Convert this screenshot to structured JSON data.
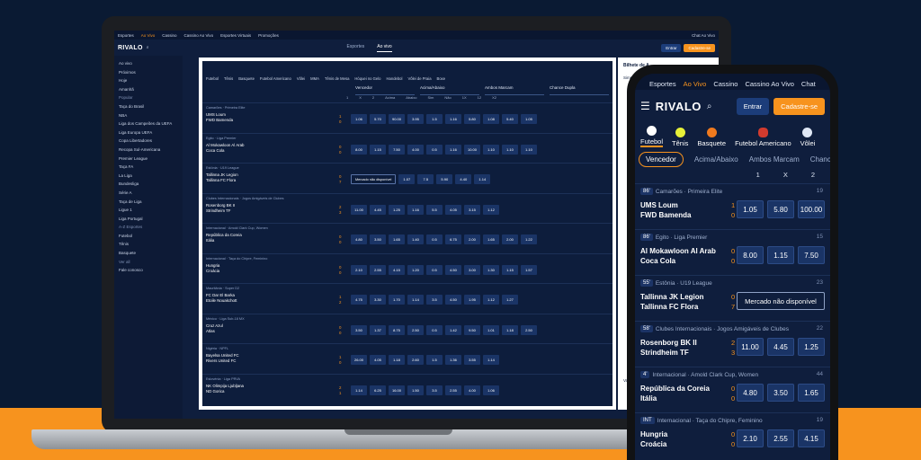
{
  "laptop": {
    "topnav": [
      "Esportes",
      "Ao Vivo",
      "Cassino",
      "Cassino Ao Vivo",
      "Esportes Virtuais",
      "Promoções"
    ],
    "chat": "Chat Ao Vivo",
    "logo": "RIVALO",
    "center_tabs": [
      "Esportes",
      "Ao vivo"
    ],
    "enter": "Entrar",
    "register": "Cadastre-se",
    "sidebar": [
      "Ao vivo",
      "Próximos",
      "Hoje",
      "Amanhã",
      "Popular",
      "Taça do Brasil",
      "NBA",
      "Liga dos Campeões da UEFA",
      "Liga Europa UEFA",
      "Copa Libertadores",
      "Recopa Sul-Americana",
      "Premier League",
      "Taça FA",
      "La Liga",
      "Bundesliga",
      "Série A",
      "Taça de Liga",
      "Ligue 1",
      "Liga Portugal",
      "A-Z Esportes",
      "Futebol",
      "Tênis",
      "Basquete",
      "Ver all",
      "Fale conosco"
    ],
    "sports": [
      "Futebol",
      "Tênis",
      "Basquete",
      "Futebol Americano",
      "Vôlei",
      "MMA",
      "Tênis de Mesa",
      "Hóquei no Gelo",
      "Handebol",
      "Vôlei de Praia",
      "Boxe"
    ],
    "markets": [
      "Vencedor",
      "Acima/Abaixo",
      "Ambos Marcam",
      "Chance Dupla"
    ],
    "colheads": [
      "1",
      "X",
      "2",
      "Acima",
      "Abaixo",
      "Sim",
      "Não",
      "1X",
      "12",
      "X2"
    ],
    "slip_title": "Bilhete de A",
    "slip_tab": "Simple",
    "slip_value": "Valor da",
    "matches": [
      {
        "league": "Camarões · Primeira Elite",
        "home": "UMS Loum",
        "away": "FWD Bamenda",
        "s1": "1",
        "s2": "0",
        "odds": [
          "1.06",
          "5.70",
          "90.00",
          "3.95",
          "1.5",
          "1.16",
          "5.80",
          "1.08",
          "5.40",
          "1.05"
        ]
      },
      {
        "league": "Egito · Liga Premier",
        "home": "Al Mokawloon Al Arab",
        "away": "Coca Cola",
        "s1": "0",
        "s2": "0",
        "odds": [
          "8.00",
          "1.15",
          "7.50",
          "4.00",
          "0.5",
          "1.16",
          "10.00",
          "1.10",
          "1.10",
          "1.10"
        ]
      },
      {
        "league": "Estônia · U19 League",
        "home": "Tallinna JK Legion",
        "away": "Tallinna FC Flora",
        "s1": "0",
        "s2": "7",
        "na": "Mercado não disponível",
        "odds": [
          "1.07",
          "7.5",
          "5.90",
          "4.40",
          "1.14"
        ]
      },
      {
        "league": "Clubes Internacionais · Jogos Amigáveis de Clubes",
        "home": "Rosenborg BK II",
        "away": "Strindheim TF",
        "s1": "2",
        "s2": "3",
        "odds": [
          "11.00",
          "4.45",
          "1.25",
          "1.16",
          "5.5",
          "4.05",
          "3.15",
          "1.12"
        ]
      },
      {
        "league": "Internacional · Amold Clark Cup, Women",
        "home": "República da Coreia",
        "away": "Itália",
        "s1": "0",
        "s2": "0",
        "odds": [
          "4.80",
          "3.50",
          "1.65",
          "1.40",
          "0.5",
          "6.75",
          "2.00",
          "1.65",
          "2.00",
          "1.22"
        ]
      },
      {
        "league": "Internacional · Taça do Chipre, Feminino",
        "home": "Hungria",
        "away": "Croácia",
        "s1": "0",
        "s2": "0",
        "odds": [
          "2.10",
          "2.55",
          "4.15",
          "1.20",
          "0.5",
          "4.50",
          "3.00",
          "1.30",
          "1.15",
          "1.57"
        ]
      },
      {
        "league": "Mauritânia · Super D2",
        "home": "FC Dar El Barka",
        "away": "Etoile Nouakchott",
        "s1": "1",
        "s2": "2",
        "odds": [
          "4.75",
          "3.30",
          "1.70",
          "1.14",
          "3.5",
          "4.50",
          "1.95",
          "1.12",
          "1.27"
        ]
      },
      {
        "league": "México · Liga Sub-18 MX",
        "home": "Cruz Azul",
        "away": "Atlas",
        "s1": "0",
        "s2": "0",
        "odds": [
          "3.50",
          "1.37",
          "8.75",
          "2.50",
          "0.5",
          "1.42",
          "9.50",
          "1.01",
          "1.18",
          "2.50"
        ]
      },
      {
        "league": "Nigéria · NPFL",
        "home": "Bayelsa United FC",
        "away": "Rivers United FC",
        "s1": "1",
        "s2": "0",
        "odds": [
          "26.00",
          "4.05",
          "1.18",
          "2.60",
          "1.5",
          "1.36",
          "3.55",
          "1.14"
        ]
      },
      {
        "league": "Eslovénia · Liga PRVA",
        "home": "NK Olimpija Ljubljana",
        "away": "ND Gorica",
        "s1": "2",
        "s2": "1",
        "odds": [
          "1.14",
          "6.25",
          "16.00",
          "1.50",
          "3.5",
          "2.55",
          "4.00",
          "1.06"
        ]
      }
    ]
  },
  "phone": {
    "topnav": [
      "Esportes",
      "Ao Vivo",
      "Cassino",
      "Cassino Ao Vivo",
      "Chat"
    ],
    "logo": "RIVALO",
    "enter": "Entrar",
    "register": "Cadastre-se",
    "sports": [
      "Futebol",
      "Tênis",
      "Basquete",
      "Futebol Americano",
      "Vôlei"
    ],
    "tabs": [
      "Vencedor",
      "Acima/Abaixo",
      "Ambos Marcam",
      "Chance D"
    ],
    "cols": [
      "1",
      "X",
      "2"
    ],
    "matches": [
      {
        "min": "86'",
        "league": "Camarões · Primeira Elite",
        "count": "19",
        "home": "UMS Loum",
        "away": "FWD Bamenda",
        "s1": "1",
        "s2": "0",
        "odds": [
          "1.05",
          "5.80",
          "100.00"
        ]
      },
      {
        "min": "86'",
        "league": "Egito · Liga Premier",
        "count": "15",
        "home": "Al Mokawloon Al Arab",
        "away": "Coca Cola",
        "s1": "0",
        "s2": "0",
        "odds": [
          "8.00",
          "1.15",
          "7.50"
        ]
      },
      {
        "min": "55'",
        "league": "Estônia · U19 League",
        "count": "23",
        "home": "Tallinna JK Legion",
        "away": "Tallinna FC Flora",
        "s1": "0",
        "s2": "7",
        "na": "Mercado não disponível"
      },
      {
        "min": "58'",
        "league": "Clubes Internacionais · Jogos Amigáveis de Clubes",
        "count": "22",
        "home": "Rosenborg BK II",
        "away": "Strindheim TF",
        "s1": "2",
        "s2": "3",
        "odds": [
          "11.00",
          "4.45",
          "1.25"
        ]
      },
      {
        "min": "4'",
        "league": "Internacional · Amold Clark Cup, Women",
        "count": "44",
        "home": "República da Coreia",
        "away": "Itália",
        "s1": "0",
        "s2": "0",
        "odds": [
          "4.80",
          "3.50",
          "1.65"
        ]
      },
      {
        "min": "INT",
        "league": "Internacional · Taça do Chipre, Feminino",
        "count": "19",
        "home": "Hungria",
        "away": "Croácia",
        "s1": "0",
        "s2": "0",
        "odds": [
          "2.10",
          "2.55",
          "4.15"
        ]
      }
    ]
  }
}
